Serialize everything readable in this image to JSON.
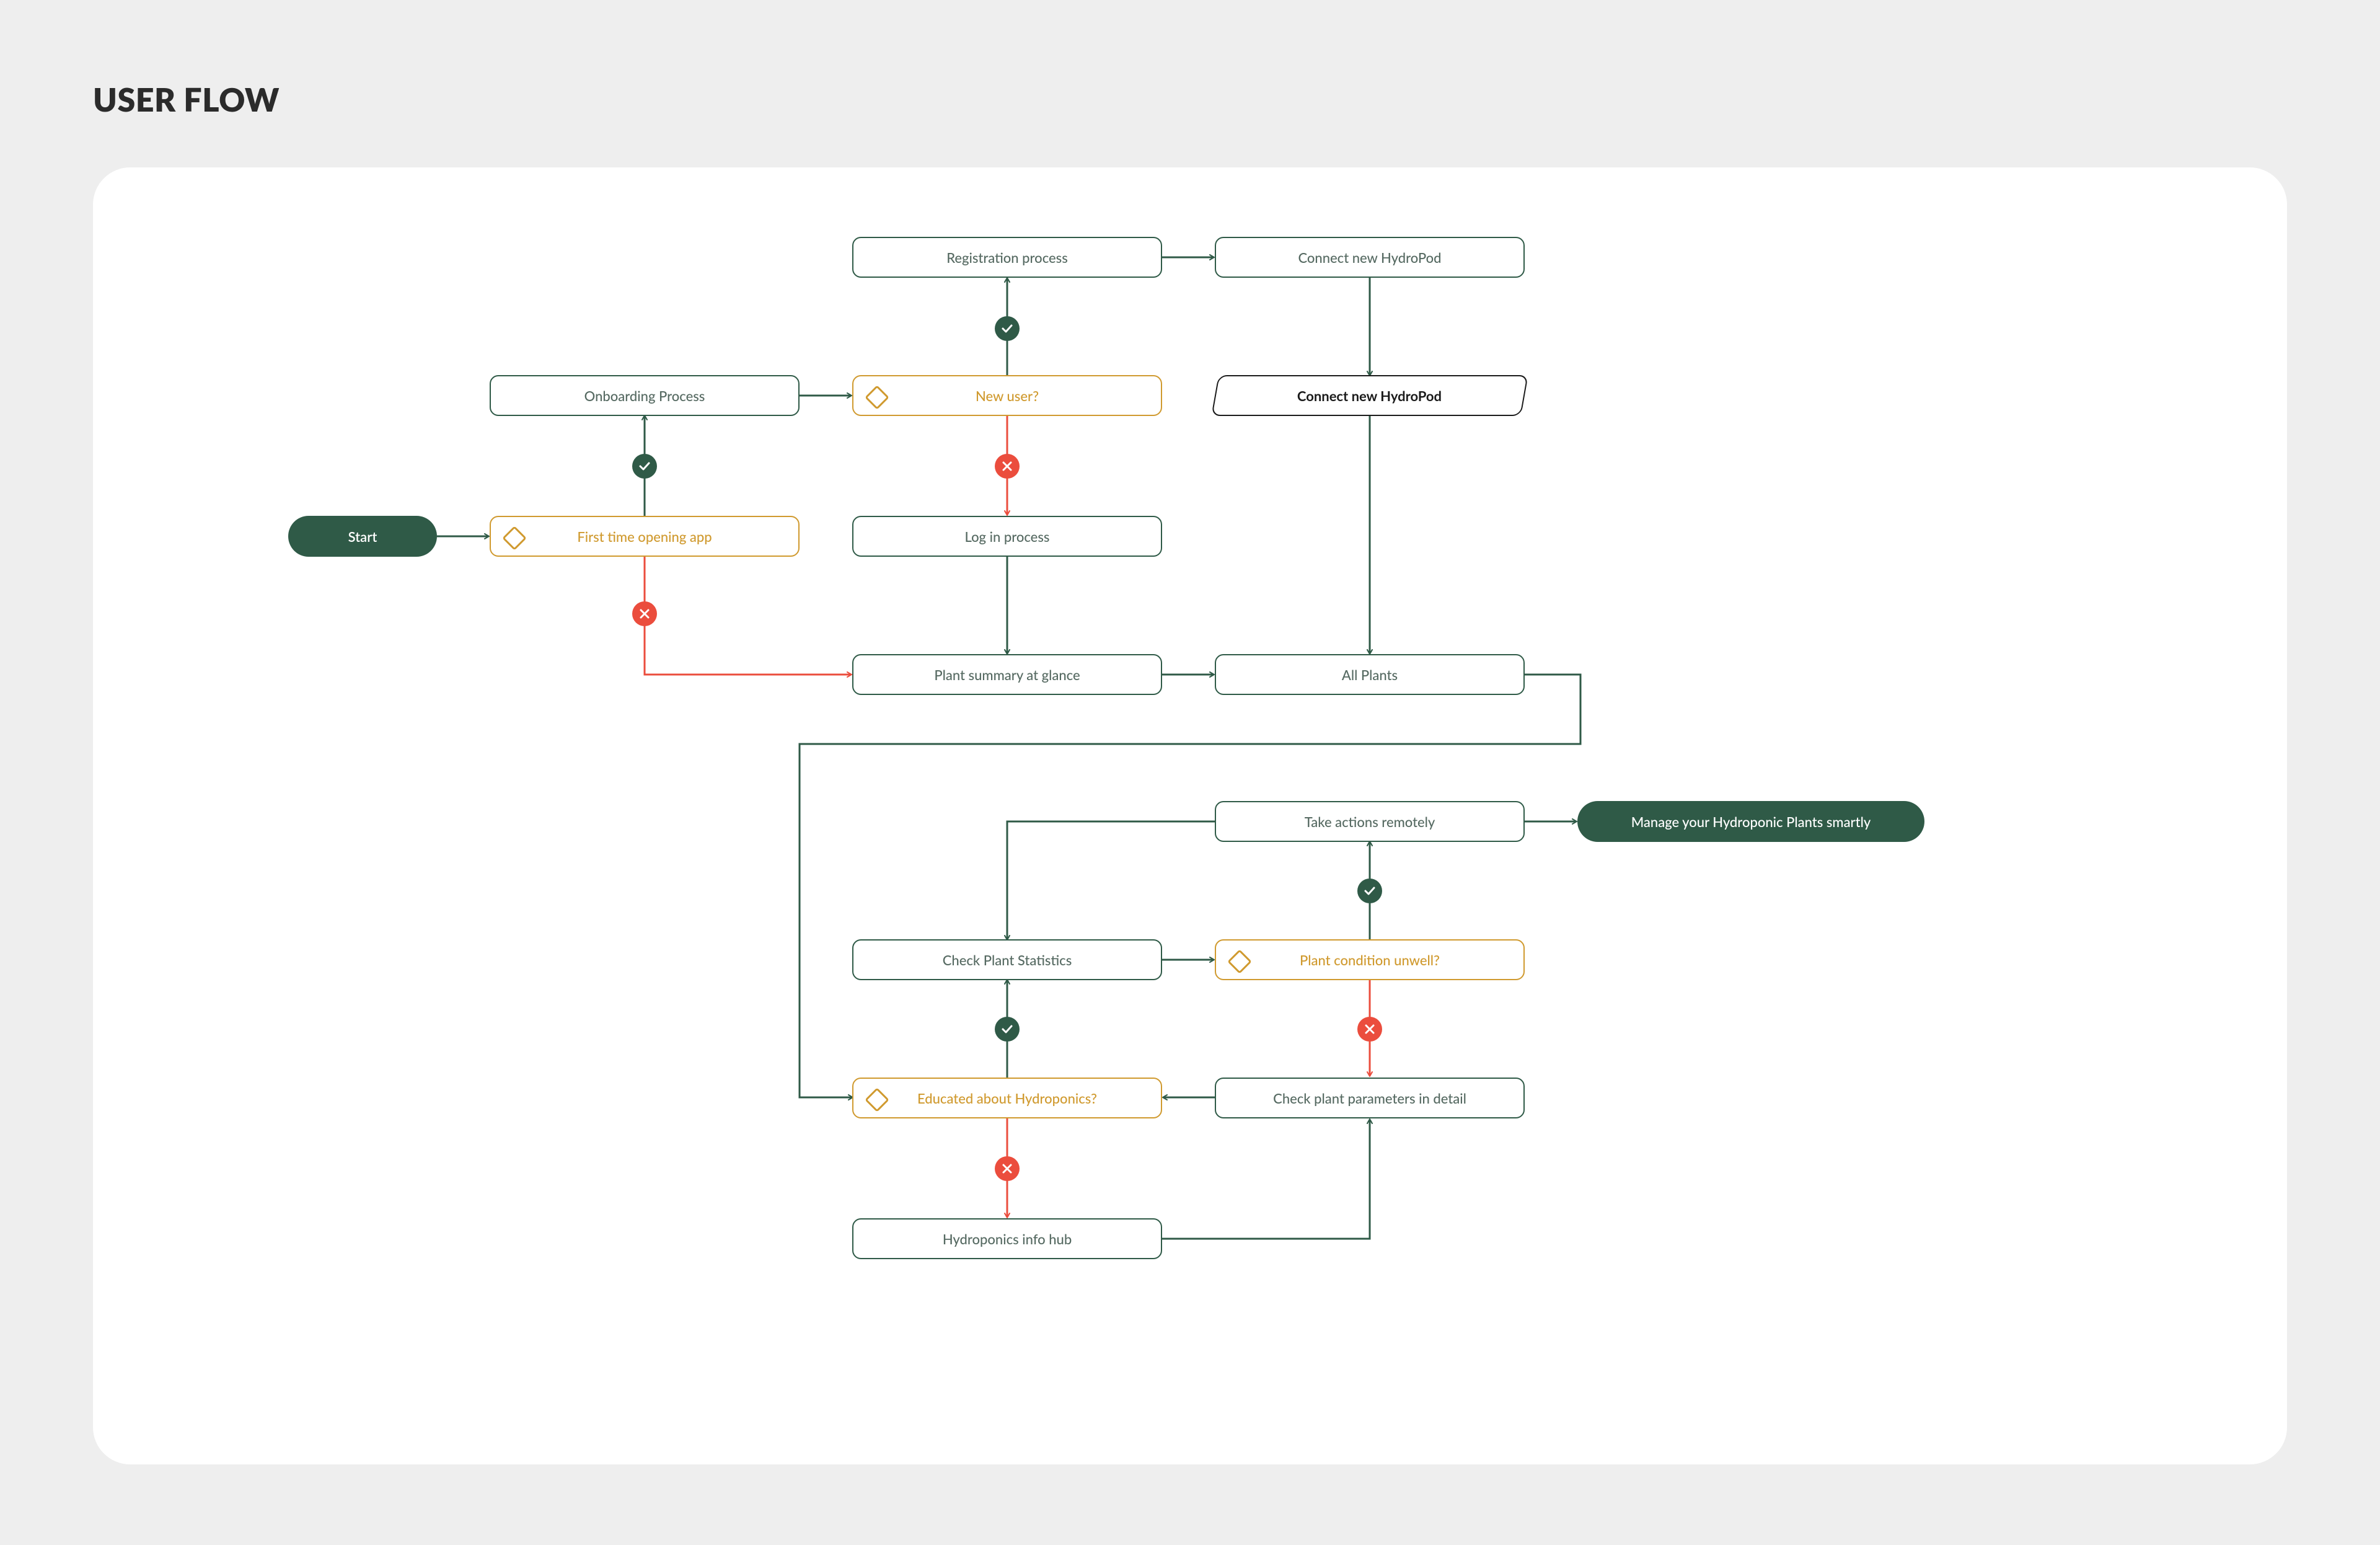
{
  "title": "USER FLOW",
  "colors": {
    "bg": "#EEEEEE",
    "card": "#FFFFFF",
    "process_stroke": "#2F5A47",
    "process_text": "#566A62",
    "decision_stroke": "#D09A2F",
    "decision_text": "#D09A2F",
    "yes_badge": "#2F5A47",
    "no_badge": "#EB4D3D",
    "terminal_fill": "#2F5A47",
    "terminal_text": "#FFFFFF",
    "skew_stroke": "#1A1A1A"
  },
  "nodes": {
    "start": {
      "label": "Start",
      "kind": "terminal-start"
    },
    "first_time": {
      "label": "First time opening app",
      "kind": "decision"
    },
    "onboarding": {
      "label": "Onboarding Process",
      "kind": "process"
    },
    "new_user": {
      "label": "New user?",
      "kind": "decision"
    },
    "registration": {
      "label": "Registration process",
      "kind": "process"
    },
    "connect_top": {
      "label": "Connect new HydroPod",
      "kind": "process"
    },
    "connect_skew": {
      "label": "Connect new HydroPod",
      "kind": "io-parallelogram"
    },
    "login": {
      "label": "Log in process",
      "kind": "process"
    },
    "plant_summary": {
      "label": "Plant summary at glance",
      "kind": "process"
    },
    "all_plants": {
      "label": "All Plants",
      "kind": "process"
    },
    "take_actions": {
      "label": "Take actions remotely",
      "kind": "process"
    },
    "manage_end": {
      "label": "Manage your Hydroponic Plants smartly",
      "kind": "terminal-end"
    },
    "check_stats": {
      "label": "Check Plant Statistics",
      "kind": "process"
    },
    "condition": {
      "label": "Plant condition unwell?",
      "kind": "decision"
    },
    "educated": {
      "label": "Educated about Hydroponics?",
      "kind": "decision"
    },
    "check_params": {
      "label": "Check plant parameters in detail",
      "kind": "process"
    },
    "info_hub": {
      "label": "Hydroponics info hub",
      "kind": "process"
    }
  },
  "edges": [
    {
      "from": "start",
      "to": "first_time"
    },
    {
      "from": "first_time",
      "to": "onboarding",
      "branch": "yes"
    },
    {
      "from": "first_time",
      "to": "plant_summary",
      "branch": "no"
    },
    {
      "from": "onboarding",
      "to": "new_user"
    },
    {
      "from": "new_user",
      "to": "registration",
      "branch": "yes"
    },
    {
      "from": "new_user",
      "to": "login",
      "branch": "no"
    },
    {
      "from": "registration",
      "to": "connect_top"
    },
    {
      "from": "connect_top",
      "to": "connect_skew"
    },
    {
      "from": "connect_skew",
      "to": "all_plants"
    },
    {
      "from": "login",
      "to": "plant_summary"
    },
    {
      "from": "plant_summary",
      "to": "all_plants"
    },
    {
      "from": "all_plants",
      "to": "educated",
      "routing": "right-down-left"
    },
    {
      "from": "educated",
      "to": "check_stats",
      "branch": "yes"
    },
    {
      "from": "educated",
      "to": "info_hub",
      "branch": "no"
    },
    {
      "from": "info_hub",
      "to": "check_params",
      "routing": "right-up"
    },
    {
      "from": "check_params",
      "to": "educated"
    },
    {
      "from": "check_stats",
      "to": "condition"
    },
    {
      "from": "condition",
      "to": "take_actions",
      "branch": "yes"
    },
    {
      "from": "condition",
      "to": "check_params",
      "branch": "no"
    },
    {
      "from": "take_actions",
      "to": "check_stats",
      "routing": "left-down"
    },
    {
      "from": "take_actions",
      "to": "manage_end"
    }
  ]
}
